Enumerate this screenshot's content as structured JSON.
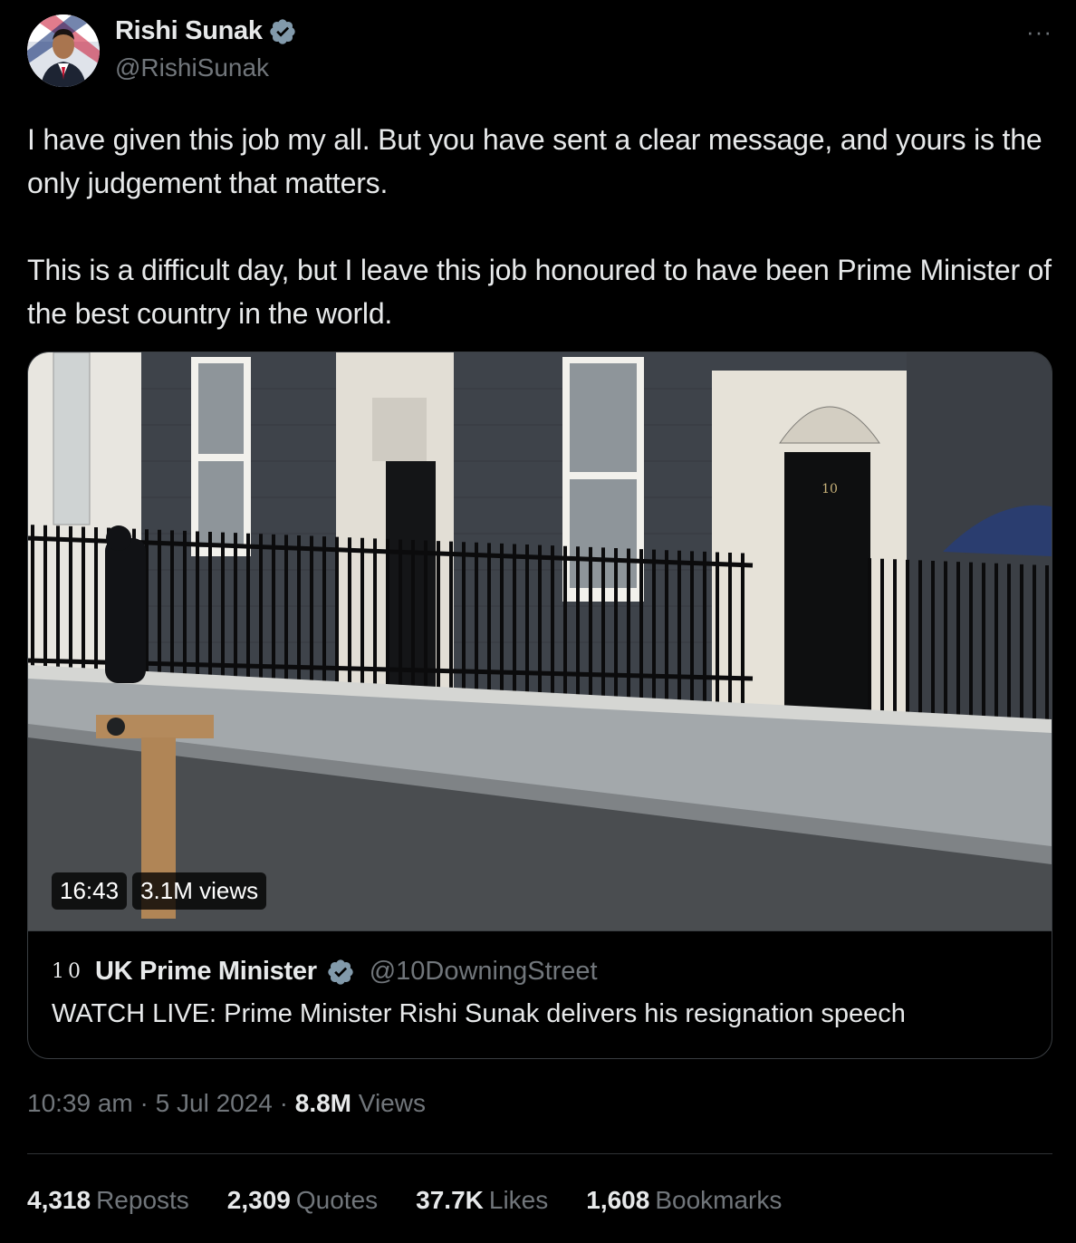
{
  "author": {
    "display_name": "Rishi Sunak",
    "handle": "@RishiSunak",
    "verified_icon": "verified-badge-icon"
  },
  "more_label": "···",
  "tweet": {
    "paragraphs": [
      "I have given this job my all. But you have sent a clear message, and yours is the only judgement that matters.",
      "This is a difficult day, but I leave this job honoured to have been Prime Minister of the best country in the world."
    ]
  },
  "video": {
    "duration": "16:43",
    "views": "3.1M views",
    "door_number": "10"
  },
  "quote": {
    "logo_text": "10",
    "name": "UK Prime Minister",
    "handle": "@10DowningStreet",
    "text": "WATCH LIVE: Prime Minister Rishi Sunak delivers his resignation speech"
  },
  "meta": {
    "time": "10:39 am",
    "separator": "·",
    "date": "5 Jul 2024",
    "views_count": "8.8M",
    "views_label": "Views"
  },
  "stats": [
    {
      "count": "4,318",
      "label": "Reposts"
    },
    {
      "count": "2,309",
      "label": "Quotes"
    },
    {
      "count": "37.7K",
      "label": "Likes"
    },
    {
      "count": "1,608",
      "label": "Bookmarks"
    }
  ],
  "colors": {
    "background": "#000000",
    "text_primary": "#e7e9ea",
    "text_secondary": "#71767b",
    "verified": "#829aab",
    "border": "#3a3e42"
  }
}
